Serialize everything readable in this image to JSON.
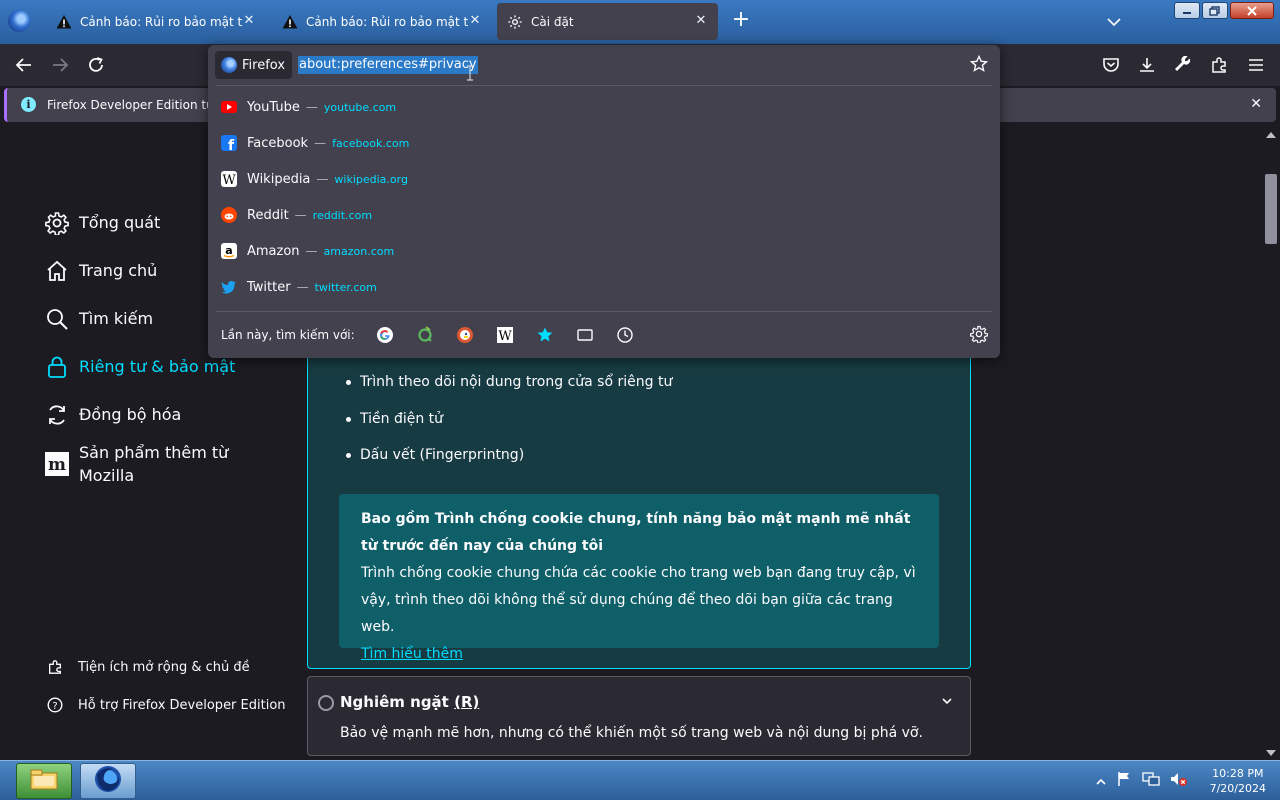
{
  "tabs": [
    {
      "label": "Cảnh báo: Rủi ro bảo mật tiềm",
      "icon": "warning-icon",
      "active": false
    },
    {
      "label": "Cảnh báo: Rủi ro bảo mật tiềm",
      "icon": "warning-icon",
      "active": false
    },
    {
      "label": "Cài đặt",
      "icon": "gear-icon",
      "active": true
    }
  ],
  "urlbar": {
    "identity_label": "Firefox",
    "url": "about:preferences#privacy",
    "suggestions": [
      {
        "title": "YouTube",
        "dash": "—",
        "url": "youtube.com",
        "icon": "youtube-icon"
      },
      {
        "title": "Facebook",
        "dash": "—",
        "url": "facebook.com",
        "icon": "facebook-icon"
      },
      {
        "title": "Wikipedia",
        "dash": "—",
        "url": "wikipedia.org",
        "icon": "wikipedia-icon"
      },
      {
        "title": "Reddit",
        "dash": "—",
        "url": "reddit.com",
        "icon": "reddit-icon"
      },
      {
        "title": "Amazon",
        "dash": "—",
        "url": "amazon.com",
        "icon": "amazon-icon"
      },
      {
        "title": "Twitter",
        "dash": "—",
        "url": "twitter.com",
        "icon": "twitter-icon"
      }
    ],
    "search_with_label": "Lần này, tìm kiếm với:",
    "engines": [
      "google-icon",
      "qwant-icon",
      "duckduckgo-icon",
      "wikipedia-icon",
      "bookmarks-star-icon",
      "tabs-icon",
      "history-icon"
    ]
  },
  "notification": {
    "message": "Firefox Developer Edition tự độ"
  },
  "sidebar": {
    "items": [
      {
        "label": "Tổng quát",
        "icon": "gear-icon"
      },
      {
        "label": "Trang chủ",
        "icon": "home-icon"
      },
      {
        "label": "Tìm kiếm",
        "icon": "search-icon"
      },
      {
        "label": "Riêng tư & bảo mật",
        "icon": "lock-icon",
        "selected": true
      },
      {
        "label": "Đồng bộ hóa",
        "icon": "sync-icon"
      },
      {
        "label": "Sản phẩm thêm từ Mozilla",
        "icon": "mozilla-icon"
      }
    ],
    "footer": [
      {
        "label": "Tiện ích mở rộng & chủ đề",
        "icon": "puzzle-icon"
      },
      {
        "label": "Hỗ trợ Firefox Developer Edition",
        "icon": "help-icon"
      }
    ]
  },
  "main": {
    "bullets": [
      "Trình theo dõi nội dung trong cửa sổ riêng tư",
      "Tiền điện tử",
      "Dấu vết (Fingerprintng)"
    ],
    "callout": {
      "title": "Bao gồm Trình chống cookie chung, tính năng bảo mật mạnh mẽ nhất từ trước đến nay của chúng tôi",
      "body": "Trình chống cookie chung chứa các cookie cho trang web bạn đang truy cập, vì vậy, trình theo dõi không thể sử dụng chúng để theo dõi bạn giữa các trang web.",
      "link": "Tìm hiểu thêm"
    },
    "strict": {
      "title": "Nghiêm ngặt",
      "accesskey": "(R)",
      "description": "Bảo vệ mạnh mẽ hơn, nhưng có thể khiến một số trang web và nội dung bị phá vỡ."
    }
  },
  "taskbar": {
    "time": "10:28 PM",
    "date": "7/20/2024"
  },
  "colors": {
    "accent": "#00ddff",
    "page_bg": "#1c1b22",
    "panel_bg": "#42414d",
    "callout_bg": "#0f5f69",
    "tabstrip": "#2a5f9e"
  }
}
